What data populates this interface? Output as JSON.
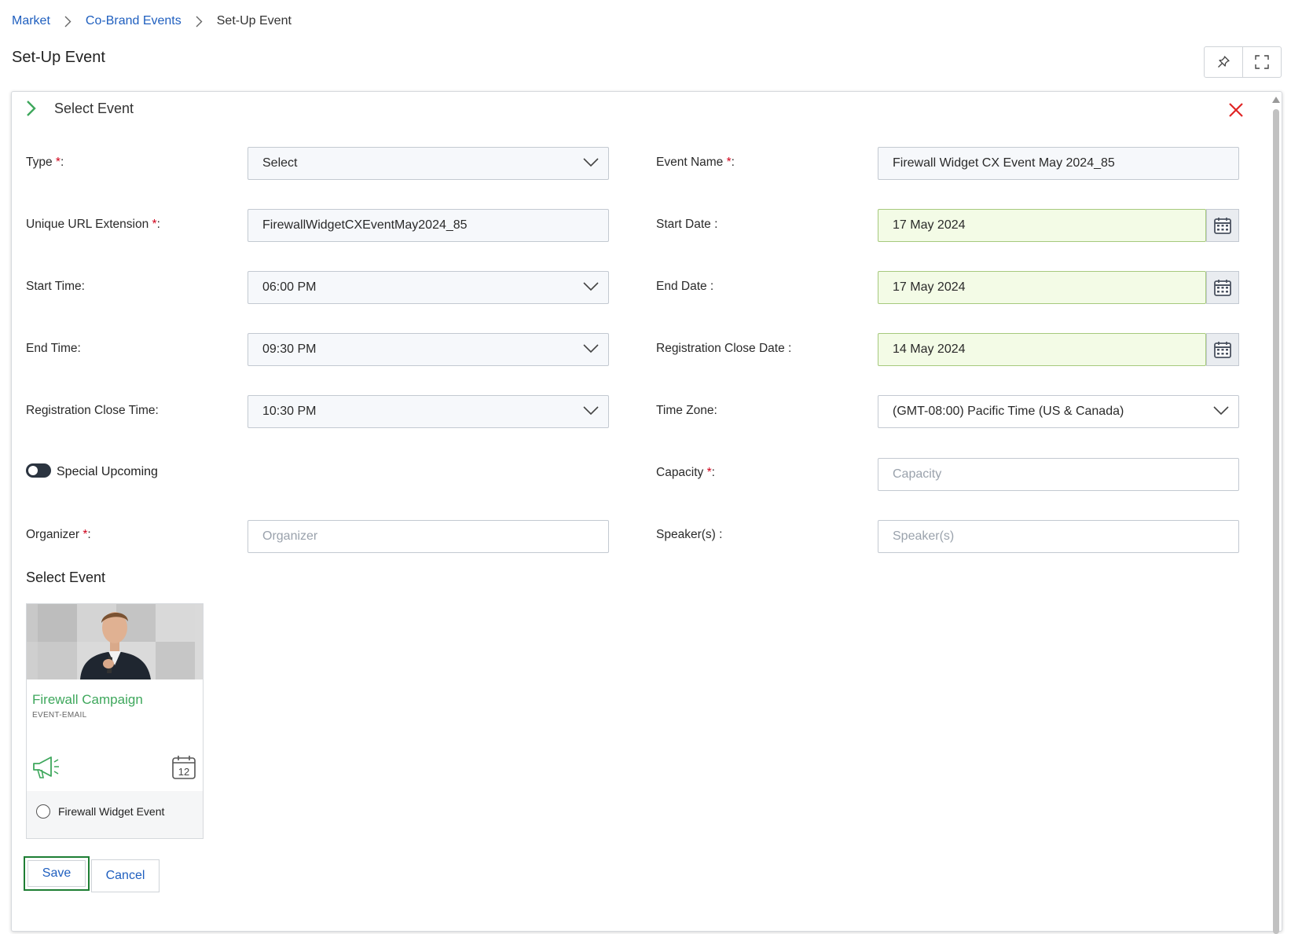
{
  "breadcrumb": {
    "items": [
      "Market",
      "Co-Brand Events"
    ],
    "current": "Set-Up Event"
  },
  "page": {
    "title": "Set-Up Event"
  },
  "panel": {
    "title": "Select Event"
  },
  "form": {
    "type": {
      "label": "Type",
      "req": "*",
      "colon": ":",
      "value": "Select"
    },
    "event_name": {
      "label": "Event Name ",
      "req": "*",
      "colon": ":",
      "value": "Firewall Widget CX Event May 2024_85"
    },
    "url_ext": {
      "label": "Unique URL Extension ",
      "req": "*",
      "colon": ":",
      "value": "FirewallWidgetCXEventMay2024_85"
    },
    "start_date": {
      "label": "Start Date :",
      "value": "17 May 2024"
    },
    "start_time": {
      "label": "Start Time:",
      "value": "06:00 PM"
    },
    "end_date": {
      "label": "End Date :",
      "value": "17 May 2024"
    },
    "end_time": {
      "label": "End Time:",
      "value": "09:30 PM"
    },
    "reg_close_date": {
      "label": "Registration Close Date :",
      "value": "14 May 2024"
    },
    "reg_close_time": {
      "label": "Registration Close Time:",
      "value": "10:30 PM"
    },
    "time_zone": {
      "label": "Time Zone:",
      "value": "(GMT-08:00) Pacific Time (US & Canada)"
    },
    "special_upcoming": {
      "label": "Special Upcoming",
      "on": false
    },
    "capacity": {
      "label": "Capacity ",
      "req": "*",
      "colon": ":",
      "placeholder": "Capacity"
    },
    "organizer": {
      "label": "Organizer ",
      "req": "*",
      "colon": ":",
      "placeholder": "Organizer"
    },
    "speakers": {
      "label": "Speaker(s) :",
      "placeholder": "Speaker(s)"
    }
  },
  "select_event": {
    "title": "Select Event",
    "card": {
      "title": "Firewall Campaign",
      "subtitle": "EVENT-EMAIL",
      "calendar_day": "12",
      "option": "Firewall Widget Event"
    }
  },
  "actions": {
    "save": "Save",
    "cancel": "Cancel"
  },
  "colors": {
    "link": "#1f5fbf",
    "required": "#d0021b",
    "accent_green": "#3ea75c",
    "close_red": "#e02424",
    "date_bg": "#f3fbe6"
  },
  "icons": {
    "pin": "pin-icon",
    "fullscreen": "fullscreen-icon",
    "close": "close-icon",
    "calendar": "calendar-icon",
    "chevron": "chevron-down-icon",
    "megaphone": "megaphone-icon"
  }
}
